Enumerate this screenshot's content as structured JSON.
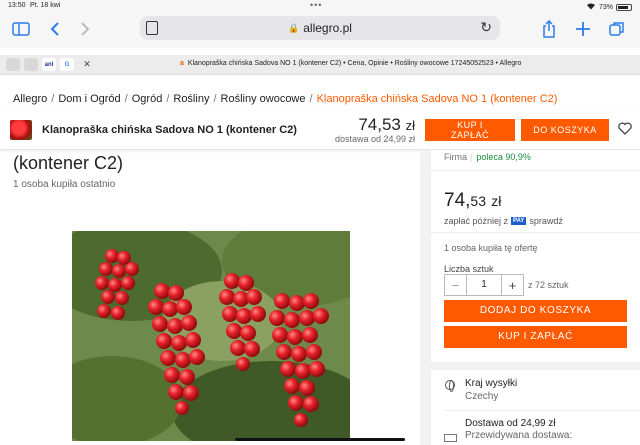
{
  "status_bar": {
    "time": "13:50",
    "date": "Pt. 18 kwi",
    "battery": "73%"
  },
  "browser": {
    "url": "allegro.pl",
    "tab_title": "Klanopraška chińska Sadova NO 1 (kontener C2) • Cena, Opinie • Rośliny owocowe 17245052523 • Allegro",
    "mini_tabs": [
      "",
      "",
      "anl",
      "G"
    ]
  },
  "breadcrumb": {
    "items": [
      "Allegro",
      "Dom i Ogród",
      "Ogród",
      "Rośliny",
      "Rośliny owocowe"
    ],
    "current": "Klanopraška chińska Sadova NO 1 (kontener C2)",
    "separator": "/"
  },
  "sticky_header": {
    "title": "Klanopraška chińska Sadova NO 1 (kontener C2)",
    "price_main": "74,53",
    "price_currency": "zł",
    "delivery": "dostawa od 24,99 zł",
    "kup_line1": "KUP I",
    "kup_line2": "ZAPŁAĆ",
    "do_koszyka": "DO KOSZYKA"
  },
  "product": {
    "title_visible": "(kontener C2)",
    "bought": "1 osoba kupiła ostatnio"
  },
  "sidebar": {
    "firma_label": "Firma",
    "firma_separator": "|",
    "poleca": "poleca 90,9%",
    "price_int": "74,",
    "price_dec": "53",
    "price_currency": "zł",
    "pay_later_prefix": "zapłać później z",
    "pay_badge": "PAY",
    "pay_later_link": "sprawdź",
    "offer_count": "1 osoba kupiła tę ofertę",
    "qty_label": "Liczba sztuk",
    "qty_value": "1",
    "qty_of": "z 72 sztuk",
    "btn_dodaj": "DODAJ DO KOSZYKA",
    "btn_kup": "KUP I ZAPŁAĆ",
    "kraj_label": "Kraj wysyłki",
    "kraj_value": "Czechy",
    "dostawa_label": "Dostawa od 24,99 zł",
    "dostawa_sub": "Przewidywana dostawa:"
  },
  "colors": {
    "brand": "#ff5a00",
    "ios_blue": "#2b7de9",
    "recommend_green": "#1a8f3c"
  },
  "icons": [
    "sidebar-icon",
    "back-icon",
    "forward-icon",
    "share-icon",
    "new-tab-icon",
    "tabs-icon",
    "reload-icon",
    "lock-icon",
    "heart-icon",
    "globe-icon",
    "truck-icon"
  ]
}
